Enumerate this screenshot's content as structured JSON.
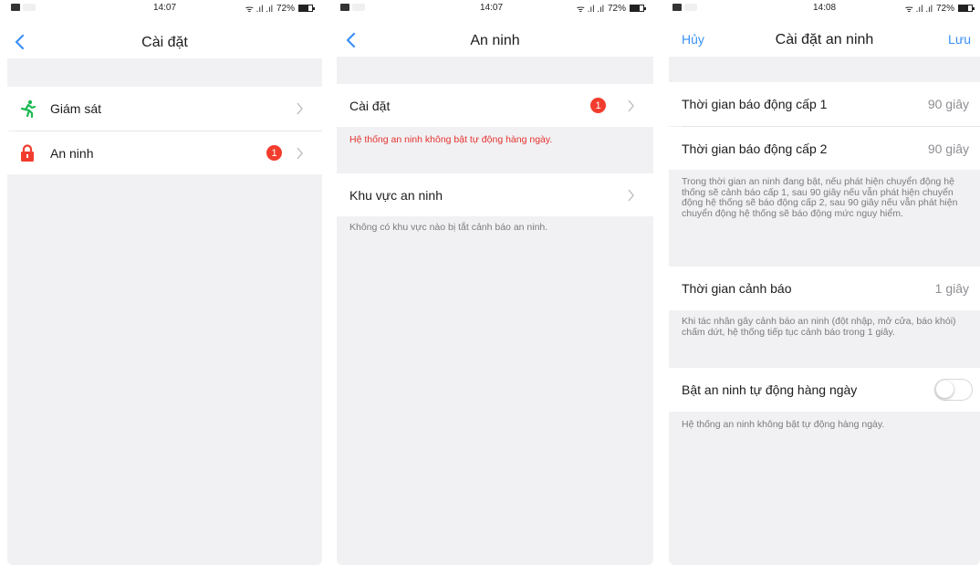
{
  "status_bars": [
    {
      "time": "14:07",
      "signal": "ᯤ .ıl .ıl",
      "battery": "72%"
    },
    {
      "time": "14:07",
      "signal": "ᯤ .ıl .ıl",
      "battery": "72%"
    },
    {
      "time": "14:08",
      "signal": "ᯤ .ıl .ıl",
      "battery": "72%"
    }
  ],
  "screen1": {
    "title": "Cài đặt",
    "items": [
      {
        "label": "Giám sát",
        "icon": "running-person-icon",
        "icon_color": "#1eb954"
      },
      {
        "label": "An ninh",
        "icon": "padlock-icon",
        "icon_color": "#f23d2e",
        "badge": "1"
      }
    ]
  },
  "screen2": {
    "title": "An ninh",
    "settings_row": {
      "label": "Cài đặt",
      "badge": "1"
    },
    "settings_note": "Hệ thống an ninh không bật tự động hàng ngày.",
    "zone_row": {
      "label": "Khu vực an ninh"
    },
    "zone_note": "Không có khu vực nào bị tắt cảnh báo an ninh."
  },
  "screen3": {
    "title": "Cài đặt an ninh",
    "cancel_label": "Hủy",
    "save_label": "Lưu",
    "level1": {
      "label": "Thời gian báo động cấp 1",
      "value": "90 giây"
    },
    "level2": {
      "label": "Thời gian báo động cấp 2",
      "value": "90 giây"
    },
    "level_note": "Trong thời gian an ninh đang bật, nếu phát hiện chuyển động hệ thống sẽ cảnh báo cấp 1, sau 90 giây nếu vẫn phát hiện chuyển động hệ thống sẽ báo động cấp 2, sau 90 giây nếu vẫn phát hiện chuyển động hệ thống sẽ báo động mức nguy hiểm.",
    "warning_time": {
      "label": "Thời gian cảnh báo",
      "value": "1 giây"
    },
    "warning_note": "Khi tác nhân gây cảnh báo an ninh (đột nhập, mở cửa, báo khói) chấm dứt, hệ thống tiếp tục cảnh báo trong 1 giây.",
    "auto_toggle": {
      "label": "Bật an ninh tự động hàng ngày",
      "state": "off"
    },
    "auto_note": "Hệ thống an ninh không bật tự động hàng ngày."
  },
  "colors": {
    "accent": "#3a8ff5",
    "badge": "#f23d2e",
    "background": "#f1f1f3"
  }
}
